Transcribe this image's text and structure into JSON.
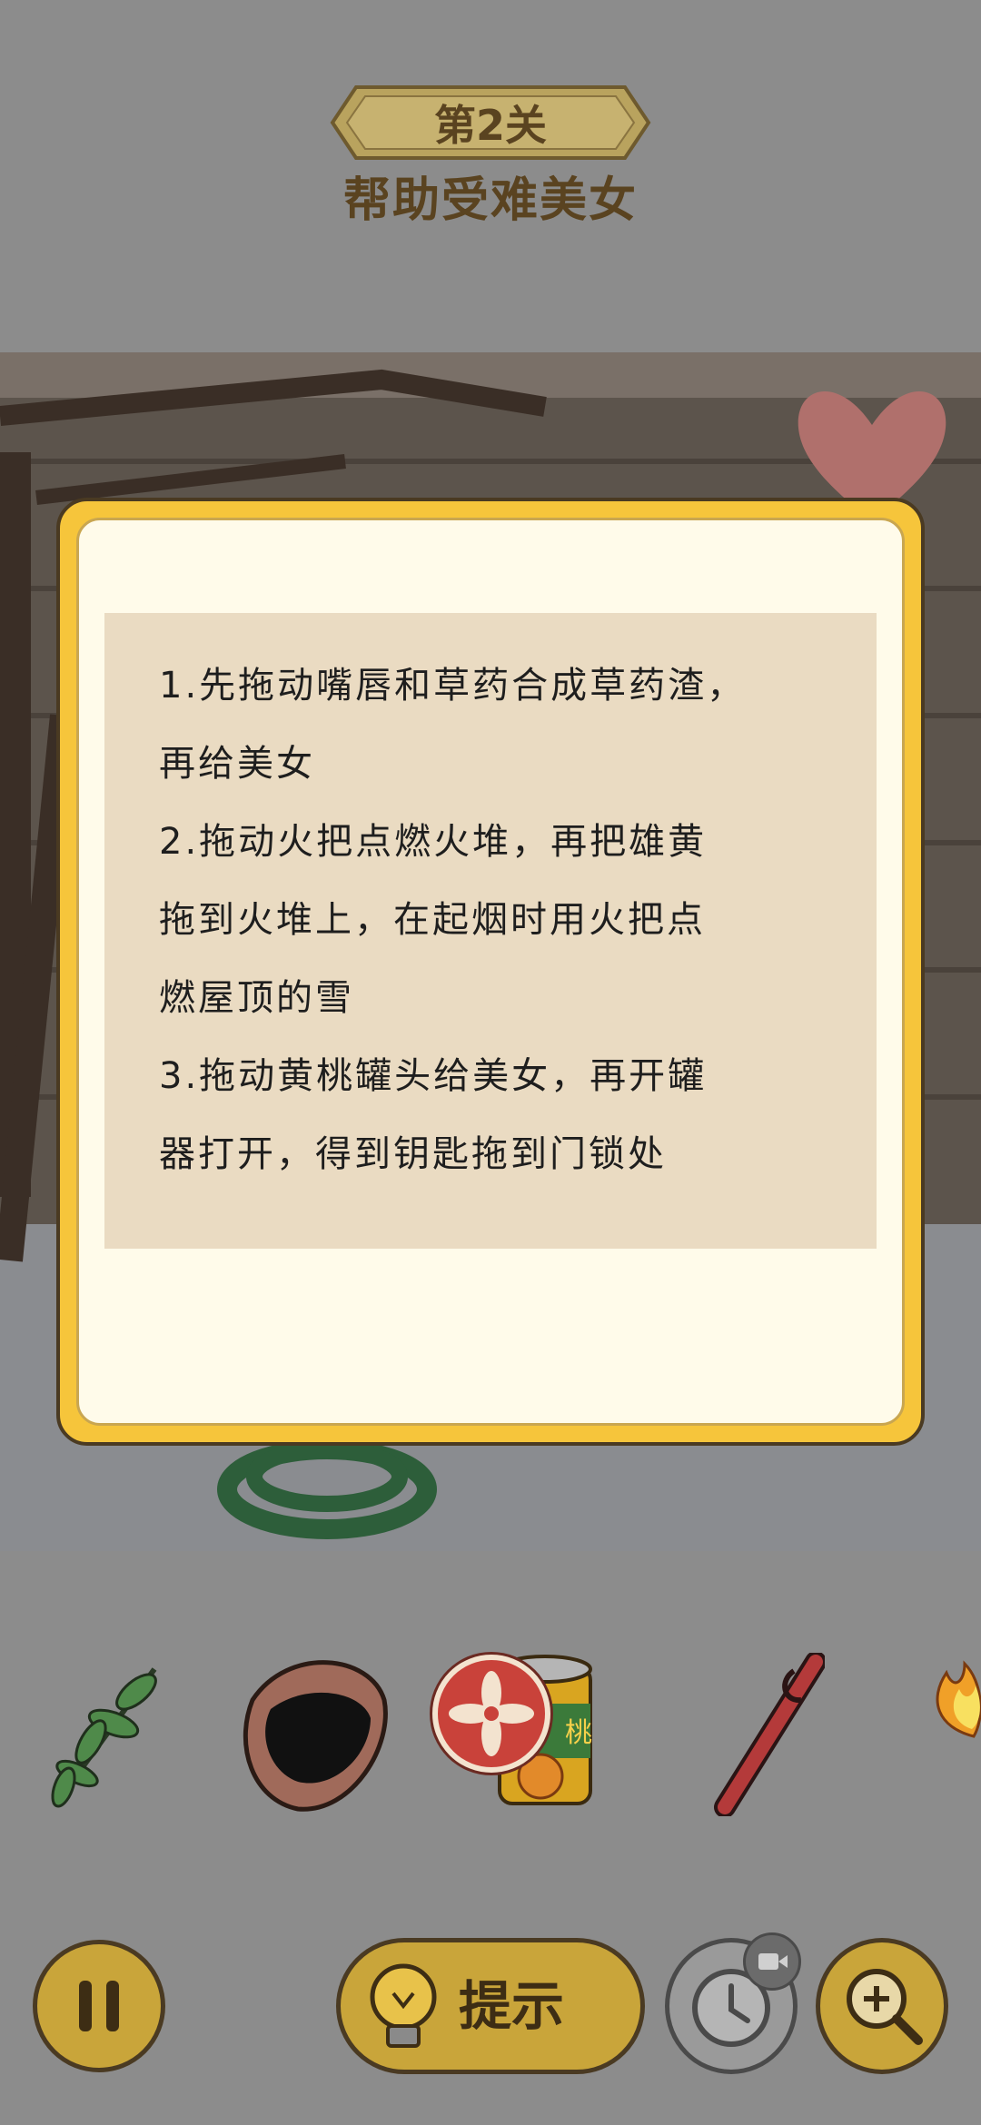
{
  "header": {
    "level": "第2关",
    "subtitle": "帮助受难美女"
  },
  "hint_panel": {
    "lines": [
      "1.先拖动嘴唇和草药合成草药渣，",
      "再给美女",
      "2.拖动火把点燃火堆，再把雄黄",
      "拖到火堆上，在起烟时用火把点",
      "燃屋顶的雪",
      "3.拖动黄桃罐头给美女，再开罐",
      "器打开，得到钥匙拖到门锁处"
    ]
  },
  "items": [
    {
      "name": "herb",
      "icon": "herb-icon"
    },
    {
      "name": "lips",
      "icon": "lips-icon"
    },
    {
      "name": "yellow-peach-can",
      "icon": "can-icon",
      "label": "桃"
    },
    {
      "name": "can-opener",
      "icon": "can-opener-icon"
    },
    {
      "name": "torch",
      "icon": "fire-icon"
    }
  ],
  "controls": {
    "hint_label": "提示",
    "pause_icon": "pause-icon",
    "timer_icon": "clock-icon",
    "video_icon": "video-icon",
    "zoom_icon": "zoom-in-icon"
  },
  "colors": {
    "gold": "#c9a53a",
    "modal_border": "#f6c53b",
    "cancel": "#c9423a"
  }
}
